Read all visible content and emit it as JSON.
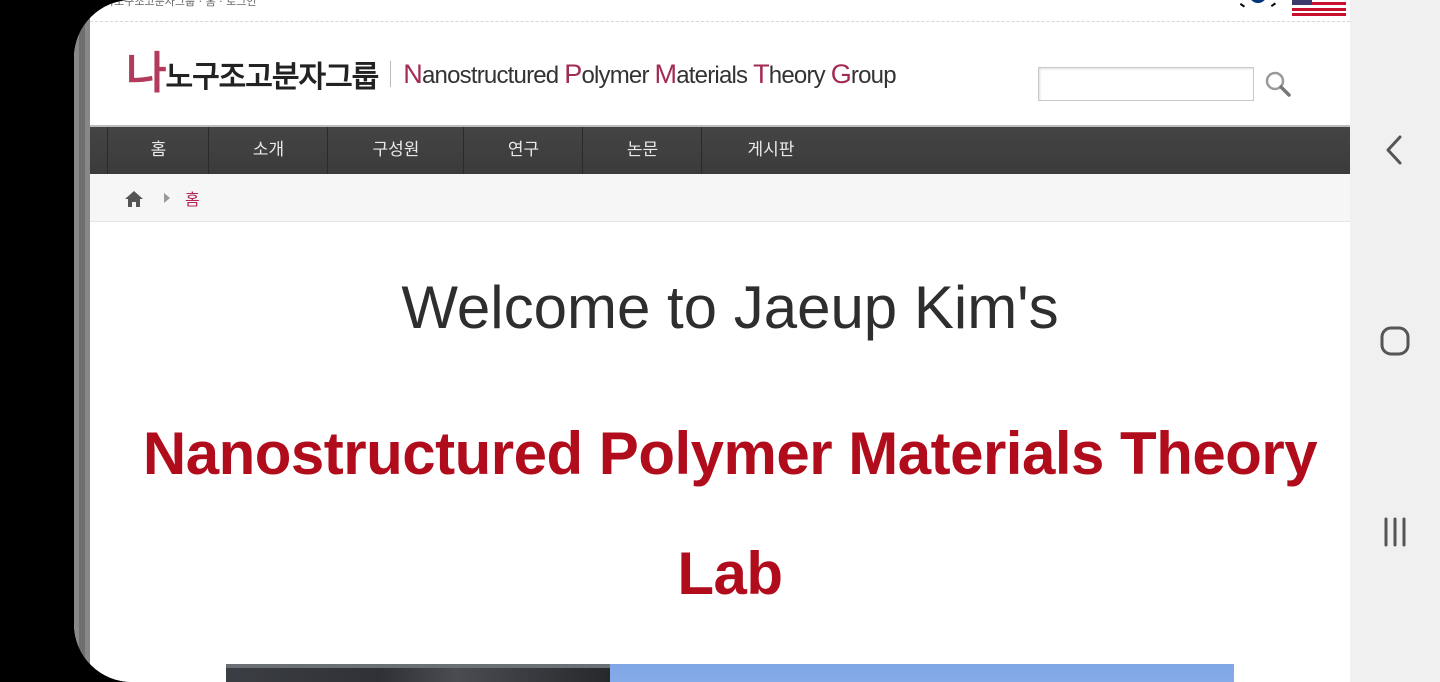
{
  "top_strip": {
    "text": "나노구조고분자그룹 · 홈 · 로그인"
  },
  "header": {
    "logo": {
      "mark": "나",
      "korean": "노구조고분자그룹",
      "english_parts": [
        {
          "cap": "N",
          "rest": "anostructured "
        },
        {
          "cap": "P",
          "rest": "olymer "
        },
        {
          "cap": "M",
          "rest": "aterials "
        },
        {
          "cap": "T",
          "rest": "heory "
        },
        {
          "cap": "G",
          "rest": "roup"
        }
      ]
    },
    "search": {
      "value": "",
      "placeholder": "",
      "icon": "magnifier-icon"
    },
    "flags": [
      "korea-flag-icon",
      "usa-flag-icon"
    ]
  },
  "nav": {
    "items": [
      "홈",
      "소개",
      "구성원",
      "연구",
      "논문",
      "게시판"
    ]
  },
  "breadcrumb": {
    "icon": "home-icon",
    "current": "홈"
  },
  "main": {
    "welcome": "Welcome to Jaeup Kim's",
    "lab_title": "Nanostructured Polymer Materials Theory Lab"
  },
  "system_nav": {
    "buttons": [
      "back-icon",
      "home-circle-icon",
      "recents-icon"
    ]
  },
  "colors": {
    "brand": "#a22a55",
    "title_red": "#b10c1b",
    "nav_bg": "#3e3e3e",
    "crumb_active": "#b2265a"
  }
}
